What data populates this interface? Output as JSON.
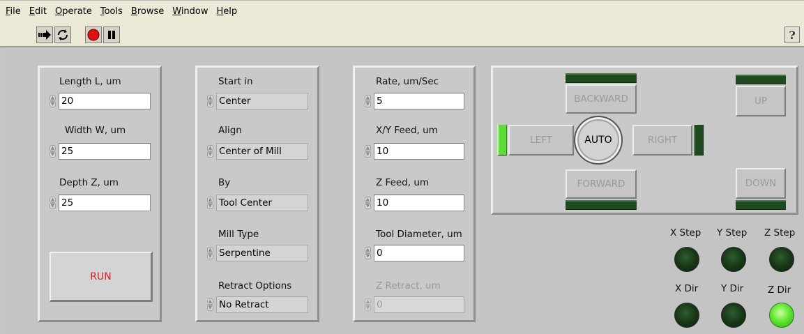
{
  "menu": {
    "file": "File",
    "edit": "Edit",
    "operate": "Operate",
    "tools": "Tools",
    "browse": "Browse",
    "window": "Window",
    "help": "Help"
  },
  "toolbar": {
    "run_icon": "run-arrow-icon",
    "run_continuous_icon": "run-continuously-icon",
    "abort_icon": "abort-icon",
    "pause_icon": "pause-icon",
    "help_label": "?"
  },
  "dimensions": {
    "length_label": "Length L, um",
    "length_value": "20",
    "width_label": "Width W, um",
    "width_value": "25",
    "depth_label": "Depth Z, um",
    "depth_value": "25",
    "run_label": "RUN"
  },
  "placement": {
    "start_label": "Start in",
    "start_value": "Center",
    "align_label": "Align",
    "align_value": "Center of Mill",
    "by_label": "By",
    "by_value": "Tool Center",
    "mill_type_label": "Mill Type",
    "mill_type_value": "Serpentine",
    "retract_label": "Retract Options",
    "retract_value": "No Retract"
  },
  "feed": {
    "rate_label": "Rate, um/Sec",
    "rate_value": "5",
    "xy_feed_label": "X/Y Feed, um",
    "xy_feed_value": "10",
    "z_feed_label": "Z Feed, um",
    "z_feed_value": "10",
    "tool_diameter_label": "Tool Diameter, um",
    "tool_diameter_value": "0",
    "z_retract_label": "Z Retract, um",
    "z_retract_value": "0"
  },
  "jog": {
    "backward": "BACKWARD",
    "forward": "FORWARD",
    "left": "LEFT",
    "right": "RIGHT",
    "auto": "AUTO",
    "up": "UP",
    "down": "DOWN",
    "left_lit": true
  },
  "indicators": {
    "x_step": "X Step",
    "y_step": "Y Step",
    "z_step": "Z Step",
    "x_dir": "X Dir",
    "y_dir": "Y Dir",
    "z_dir": "Z Dir",
    "z_dir_on": true,
    "led_on_color": "#5fdc3a",
    "led_off_color": "#163516"
  }
}
